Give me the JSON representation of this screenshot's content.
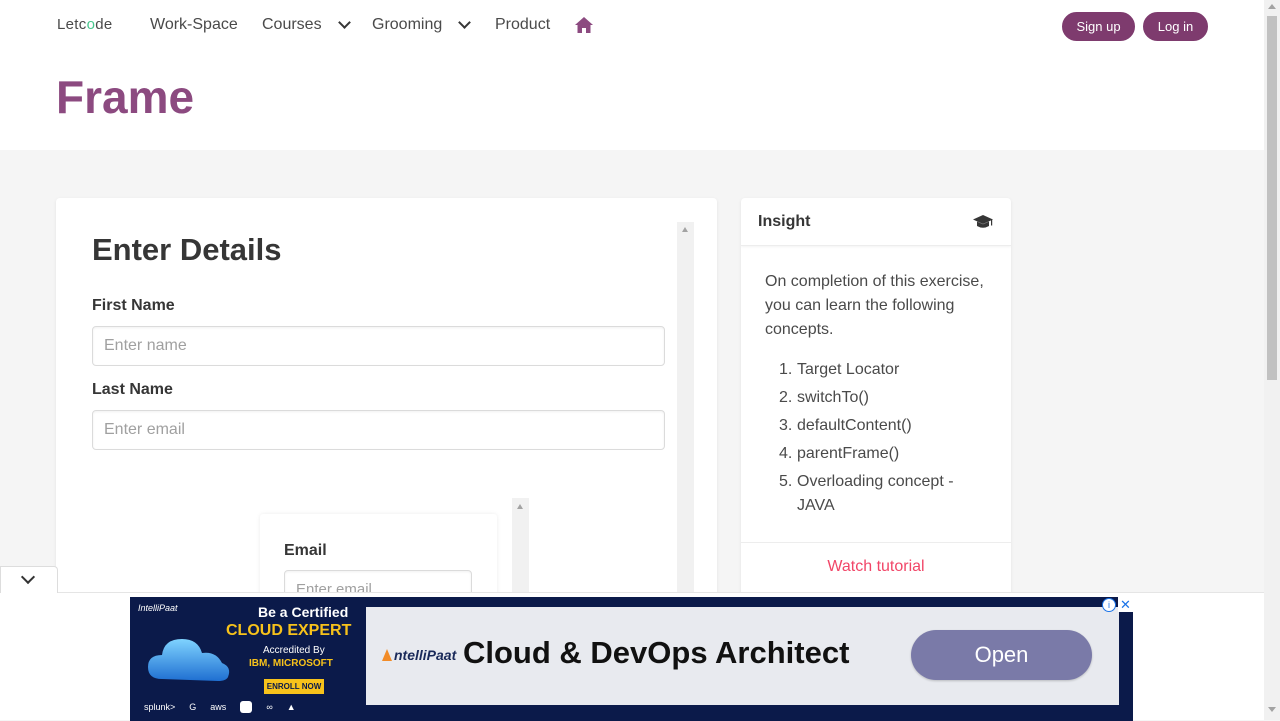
{
  "header": {
    "logo_text_1": "Letc",
    "logo_text_o": "o",
    "logo_text_2": "de",
    "nav": {
      "workspace": "Work-Space",
      "courses": "Courses",
      "grooming": "Grooming",
      "product": "Product"
    },
    "signup": "Sign up",
    "login": "Log in"
  },
  "page": {
    "title": "Frame"
  },
  "form": {
    "heading": "Enter Details",
    "first_name_label": "First Name",
    "first_name_placeholder": "Enter name",
    "first_name_value": "",
    "last_name_label": "Last Name",
    "last_name_placeholder": "Enter email",
    "last_name_value": "",
    "inner_frame": {
      "email_label": "Email",
      "email_placeholder": "Enter email"
    }
  },
  "insight": {
    "title": "Insight",
    "intro": "On completion of this exercise, you can learn the following concepts.",
    "concepts": [
      {
        "num": "1.",
        "text": "Target Locator"
      },
      {
        "num": "2.",
        "text": "switchTo()"
      },
      {
        "num": "3.",
        "text": "defaultContent()"
      },
      {
        "num": "4.",
        "text": "parentFrame()"
      },
      {
        "num": "5.",
        "text": "Overloading concept - JAVA"
      }
    ],
    "watch": "Watch tutorial"
  },
  "ad": {
    "brand_small": "IntelliPaat",
    "line1": "Be a Certified",
    "line2": "CLOUD EXPERT",
    "line3": "Accredited By",
    "line4": "IBM, MICROSOFT",
    "enroll": "ENROLL NOW",
    "logos": [
      "splunk>",
      "G",
      "aws",
      "",
      "∞",
      "▲"
    ],
    "brand": "ntelliPaat",
    "headline": "Cloud & DevOps Architect",
    "open": "Open",
    "info": "i",
    "close": "✕"
  },
  "colors": {
    "brand": "#7e3b6e",
    "title": "#8c4a80",
    "watch": "#f14668",
    "ad_bg": "#0b1a4a",
    "ad_accent": "#f7c21b"
  }
}
